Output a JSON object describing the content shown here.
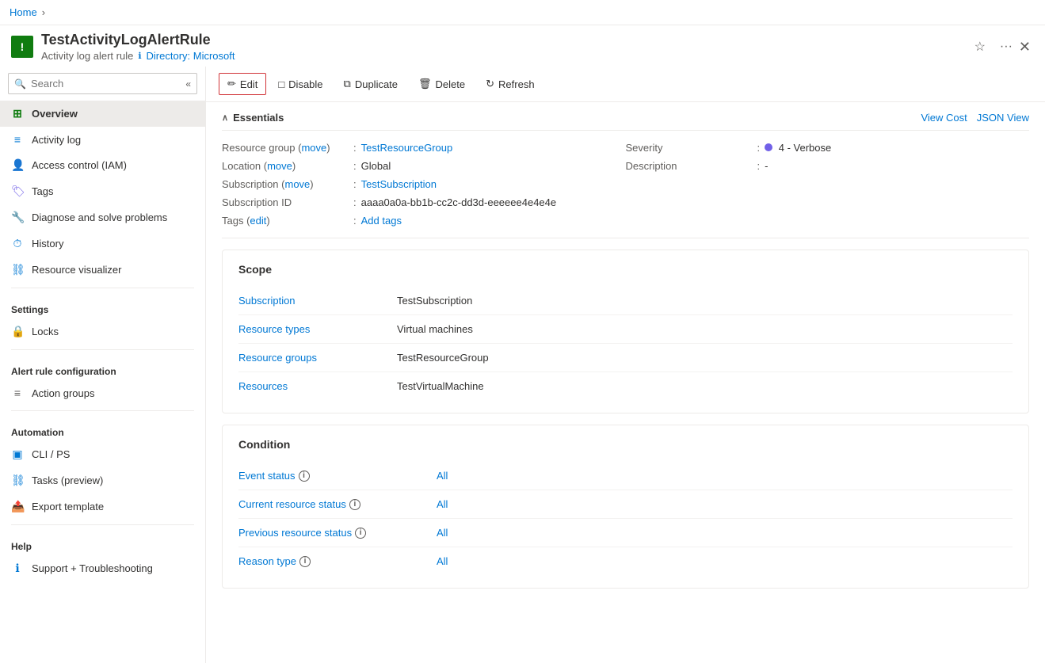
{
  "breadcrumb": {
    "home": "Home",
    "separator": "›"
  },
  "resource": {
    "icon_text": "!",
    "name": "TestActivityLogAlertRule",
    "subtitle": "Activity log alert rule",
    "directory_label": "Directory: Microsoft"
  },
  "toolbar": {
    "edit_label": "Edit",
    "disable_label": "Disable",
    "duplicate_label": "Duplicate",
    "delete_label": "Delete",
    "refresh_label": "Refresh"
  },
  "sidebar": {
    "search_placeholder": "Search",
    "items": [
      {
        "id": "overview",
        "label": "Overview",
        "active": true,
        "icon": "⊞"
      },
      {
        "id": "activity-log",
        "label": "Activity log",
        "active": false,
        "icon": "📋"
      },
      {
        "id": "access-control",
        "label": "Access control (IAM)",
        "active": false,
        "icon": "👤"
      },
      {
        "id": "tags",
        "label": "Tags",
        "active": false,
        "icon": "🏷"
      },
      {
        "id": "diagnose",
        "label": "Diagnose and solve problems",
        "active": false,
        "icon": "🔧"
      },
      {
        "id": "history",
        "label": "History",
        "active": false,
        "icon": "⏱"
      },
      {
        "id": "resource-visualizer",
        "label": "Resource visualizer",
        "active": false,
        "icon": "⛓"
      }
    ],
    "settings_section": "Settings",
    "settings_items": [
      {
        "id": "locks",
        "label": "Locks",
        "icon": "🔒"
      }
    ],
    "alert_section": "Alert rule configuration",
    "alert_items": [
      {
        "id": "action-groups",
        "label": "Action groups",
        "icon": "📋"
      }
    ],
    "automation_section": "Automation",
    "automation_items": [
      {
        "id": "cli-ps",
        "label": "CLI / PS",
        "icon": "▣"
      },
      {
        "id": "tasks",
        "label": "Tasks (preview)",
        "icon": "⛓"
      },
      {
        "id": "export",
        "label": "Export template",
        "icon": "📤"
      }
    ],
    "help_section": "Help",
    "help_items": [
      {
        "id": "support",
        "label": "Support + Troubleshooting",
        "icon": "ℹ"
      }
    ]
  },
  "essentials": {
    "title": "Essentials",
    "view_cost_label": "View Cost",
    "json_view_label": "JSON View",
    "resource_group_label": "Resource group (move)",
    "resource_group_value": "TestResourceGroup",
    "location_label": "Location (move)",
    "location_value": "Global",
    "subscription_label": "Subscription (move)",
    "subscription_value": "TestSubscription",
    "subscription_id_label": "Subscription ID",
    "subscription_id_value": "aaaa0a0a-bb1b-cc2c-dd3d-eeeeee4e4e4e",
    "tags_label": "Tags (edit)",
    "tags_value": "Add tags",
    "severity_label": "Severity",
    "severity_value": "4 - Verbose",
    "description_label": "Description",
    "description_value": "-"
  },
  "scope": {
    "title": "Scope",
    "rows": [
      {
        "label": "Subscription",
        "value": "TestSubscription"
      },
      {
        "label": "Resource types",
        "value": "Virtual machines"
      },
      {
        "label": "Resource groups",
        "value": "TestResourceGroup"
      },
      {
        "label": "Resources",
        "value": "TestVirtualMachine"
      }
    ]
  },
  "condition": {
    "title": "Condition",
    "rows": [
      {
        "label": "Event status",
        "value": "All",
        "has_info": true
      },
      {
        "label": "Current resource status",
        "value": "All",
        "has_info": true
      },
      {
        "label": "Previous resource status",
        "value": "All",
        "has_info": true
      },
      {
        "label": "Reason type",
        "value": "All",
        "has_info": true
      }
    ]
  }
}
